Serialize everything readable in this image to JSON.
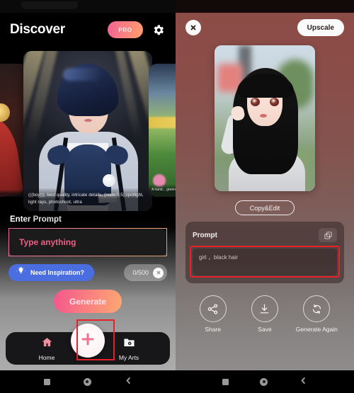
{
  "left_panel": {
    "header": {
      "title": "Discover",
      "pro_badge": "PRO",
      "settings_icon": "gear-icon"
    },
    "carousel": {
      "center_card": {
        "caption": "(((boy))), best quality, intricate details, (nude:0.5),spotlight, light rays, photoshoot, ultra"
      },
      "right_card": {
        "caption": "A hand... greenh..."
      }
    },
    "prompt_section": {
      "label": "Enter Prompt",
      "input_placeholder": "Type anything",
      "input_value": "",
      "inspiration_button": "Need Inspiration?",
      "inspiration_icon": "lightbulb-icon",
      "char_counter": "0/500",
      "clear_icon": "close-circle-icon",
      "generate_button": "Generate"
    },
    "bottom_nav": {
      "items": [
        {
          "label": "Home",
          "icon": "home-icon"
        },
        {
          "label": "My Arts",
          "icon": "folder-photo-icon"
        }
      ],
      "fab_icon": "plus-icon"
    }
  },
  "right_panel": {
    "header": {
      "close_icon": "close-icon",
      "upscale_button": "Upscale"
    },
    "copy_edit_button": "Copy&Edit",
    "prompt_card": {
      "title": "Prompt",
      "copy_icon": "copy-icon",
      "text": "girl ，black hair"
    },
    "actions": [
      {
        "label": "Share",
        "icon": "share-icon"
      },
      {
        "label": "Save",
        "icon": "download-icon"
      },
      {
        "label": "Generate\nAgain",
        "icon": "refresh-icon"
      }
    ]
  },
  "system_nav": {
    "recent_icon": "square-icon",
    "home_icon": "circle-icon",
    "back_icon": "chevron-left-icon"
  },
  "colors": {
    "accent_pink": "#f3568c",
    "accent_orange": "#fba972",
    "inspiration_blue": "#4a6ee0",
    "highlight_red": "#e8202a",
    "right_panel_top": "#8d4b46",
    "right_panel_bottom": "#939090"
  }
}
